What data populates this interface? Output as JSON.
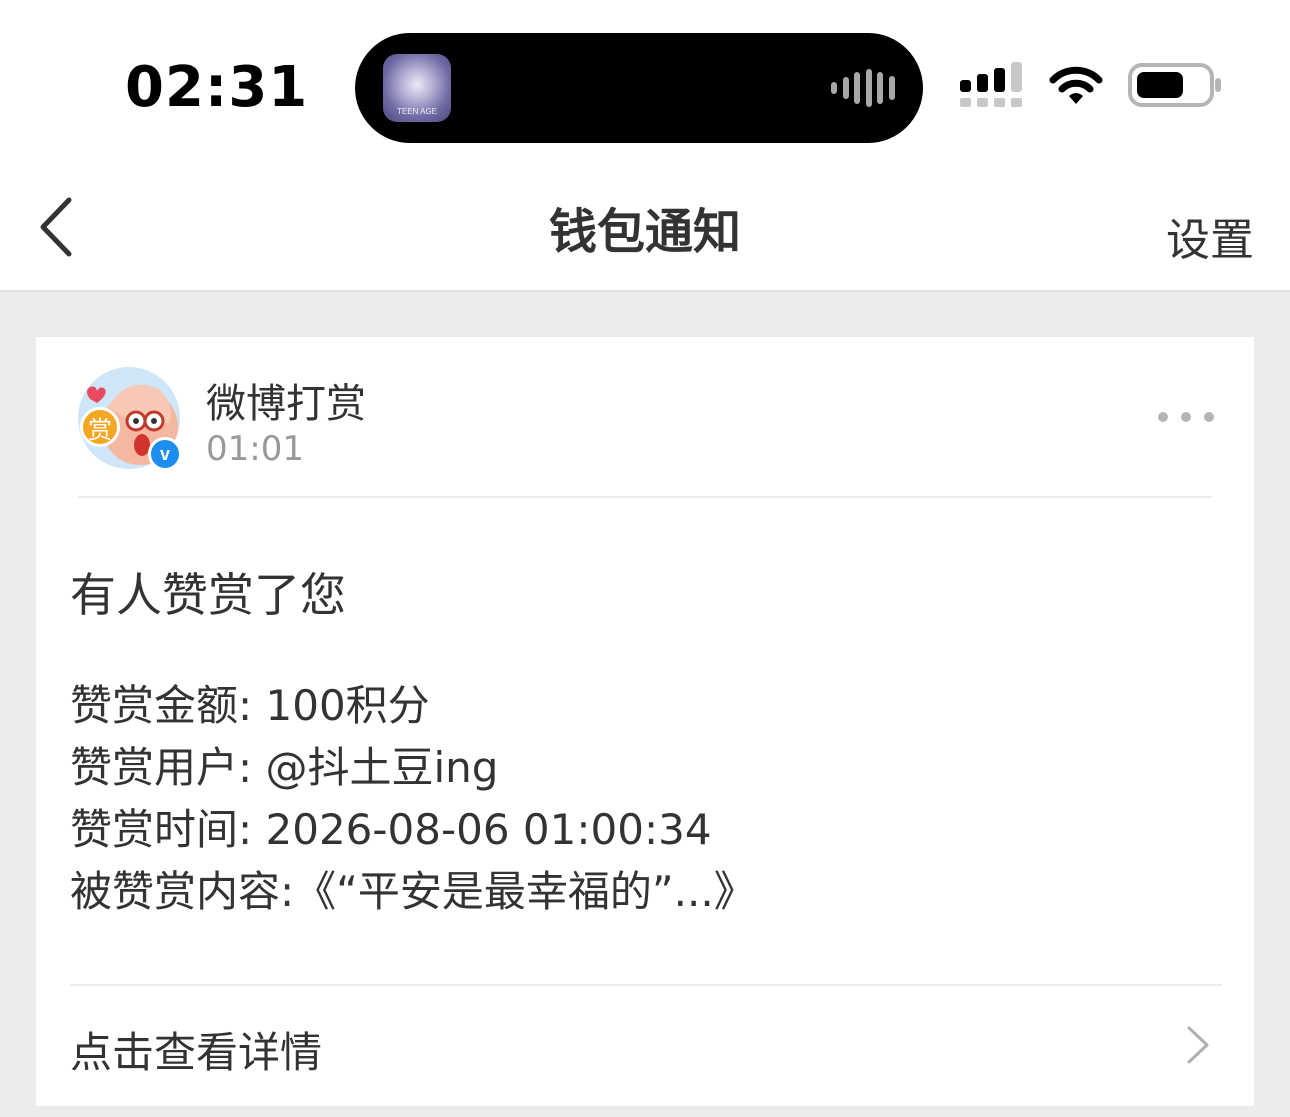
{
  "status_bar": {
    "time": "02:31",
    "now_playing_art_text": "TEEN AGE"
  },
  "nav": {
    "title": "钱包通知",
    "settings_label": "设置"
  },
  "notification": {
    "sender_name": "微博打赏",
    "time": "01:01",
    "avatar_badge_text": "赏",
    "verified_mark": "v",
    "title": "有人赞赏了您",
    "details": [
      "赞赏金额: 100积分",
      "赞赏用户: @抖土豆ing",
      "赞赏时间: 2026-08-06 01:00:34",
      "被赞赏内容:《“平安是最幸福的”...》"
    ],
    "view_details_label": "点击查看详情"
  },
  "colors": {
    "page_background": "#ececec",
    "card_background": "#ffffff",
    "primary_text": "#333333",
    "secondary_text": "#999999",
    "verified_blue": "#1e8df0"
  }
}
